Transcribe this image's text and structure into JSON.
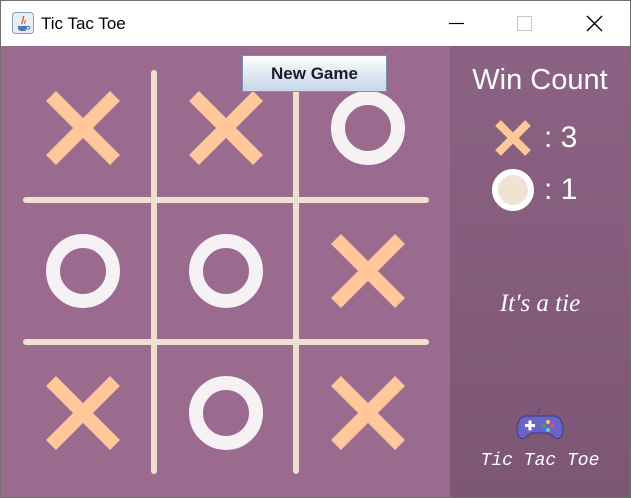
{
  "window": {
    "title": "Tic Tac Toe",
    "controls": [
      "minimize",
      "maximize",
      "close"
    ]
  },
  "toolbar": {
    "new_game_label": "New Game"
  },
  "board": {
    "cells": [
      "X",
      "X",
      "O",
      "O",
      "O",
      "X",
      "X",
      "O",
      "X"
    ]
  },
  "sidebar": {
    "title": "Win Count",
    "scores": {
      "x_text": ": 3",
      "o_text": ": 1"
    },
    "status": "It's a tie",
    "footer": "Tic Tac Toe"
  },
  "icons": [
    "java-app-icon",
    "x-mark-icon",
    "o-mark-icon",
    "gamepad-icon"
  ],
  "colors": {
    "board": "#9a6b8f",
    "sidebar": "#845b7c",
    "grid_line": "#f1dfd0",
    "x_mark": "#ffc79a",
    "o_mark": "#f6f1f3",
    "o_score_fill": "#f0e3d3"
  }
}
